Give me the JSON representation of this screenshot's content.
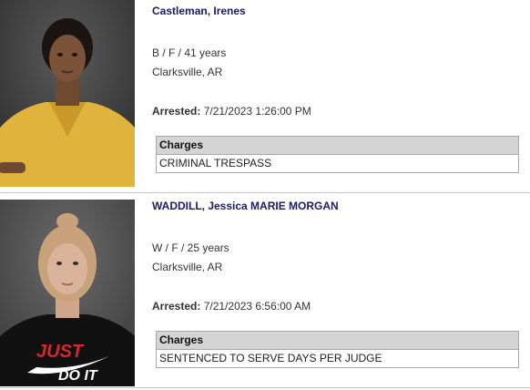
{
  "records": [
    {
      "name": "Castleman, Irenes",
      "demographics": "B / F / 41 years",
      "location": "Clarksville, AR",
      "arrested_label": "Arrested:",
      "arrested_value": "7/21/2023 1:26:00 PM",
      "charges_header": "Charges",
      "charges": [
        "CRIMINAL TRESPASS"
      ],
      "photo_icon": "mugshot-photo",
      "photo_palette": {
        "background": "#3a3a3a",
        "skin": "#7a5338",
        "hair": "#1c1410",
        "shirt": "#e0b43c"
      }
    },
    {
      "name": "WADDILL, Jessica MARIE MORGAN",
      "demographics": "W / F / 25 years",
      "location": "Clarksville, AR",
      "arrested_label": "Arrested:",
      "arrested_value": "7/21/2023 6:56:00 AM",
      "charges_header": "Charges",
      "charges": [
        "SENTENCED TO SERVE DAYS PER JUDGE"
      ],
      "photo_icon": "mugshot-photo",
      "shirt_text": [
        "JUST",
        "DO IT"
      ],
      "photo_palette": {
        "background": "#4a4a4a",
        "skin": "#d9b39a",
        "hair": "#c8a27a",
        "shirt": "#111111",
        "logo_red": "#d8262a"
      }
    }
  ]
}
